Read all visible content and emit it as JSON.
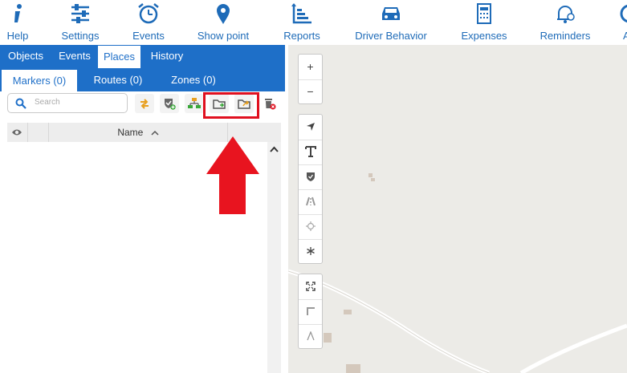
{
  "topbar": {
    "items": [
      {
        "label": "Help",
        "icon": "info-icon"
      },
      {
        "label": "Settings",
        "icon": "sliders-icon"
      },
      {
        "label": "Events",
        "icon": "alarm-clock-icon"
      },
      {
        "label": "Show point",
        "icon": "map-pin-icon"
      },
      {
        "label": "Reports",
        "icon": "chart-bars-icon"
      },
      {
        "label": "Driver Behavior",
        "icon": "car-icon"
      },
      {
        "label": "Expenses",
        "icon": "calculator-document-icon"
      },
      {
        "label": "Reminders",
        "icon": "bell-clock-icon"
      },
      {
        "label": "A",
        "icon": "partial-icon"
      }
    ]
  },
  "tabs": {
    "primary": [
      "Objects",
      "Events",
      "Places",
      "History"
    ],
    "active_primary": "Places",
    "secondary": [
      "Markers (0)",
      "Routes (0)",
      "Zones (0)"
    ],
    "active_secondary": "Markers (0)"
  },
  "search": {
    "placeholder": "Search"
  },
  "toolbar_icons": [
    "reload-icon",
    "add-marker-icon",
    "group-icon",
    "import-folder-icon",
    "export-folder-icon",
    "delete-all-icon"
  ],
  "grid": {
    "columns": [
      "",
      "",
      "Name"
    ]
  },
  "map_controls": {
    "zoom": {
      "in": "+",
      "out": "−"
    },
    "tools": [
      "navigate-icon",
      "text-icon",
      "shield-icon",
      "road-icon",
      "gear-outline-icon",
      "asterisk-icon"
    ],
    "tools2": [
      "fullscreen-icon",
      "corner-icon",
      "chevron-up-icon"
    ]
  },
  "colors": {
    "brand": "#1e6fc8",
    "highlight": "#e0101f",
    "map_bg": "#ecebe7"
  }
}
